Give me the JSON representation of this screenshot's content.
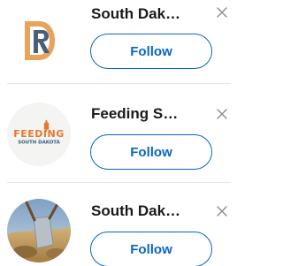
{
  "suggestions": [
    {
      "name": "South Dakota Department of Revenue",
      "display_name": "South Dak…",
      "follow_label": "Follow",
      "avatar_icon": "dor-logo"
    },
    {
      "name": "Feeding South Dakota",
      "display_name": "Feeding S…",
      "follow_label": "Follow",
      "avatar_icon": "feeding-south-dakota-logo",
      "logo_text_top": "FEEDING",
      "logo_text_bottom": "SOUTH DAKOTA"
    },
    {
      "name": "South Dakota",
      "display_name": "South Dak…",
      "follow_label": "Follow",
      "avatar_icon": "landscape-photo"
    }
  ],
  "colors": {
    "accent": "#0a66c2",
    "dismiss": "#8c8c8c",
    "divider": "#e6e6e6",
    "logo_orange": "#e8772e",
    "logo_blue": "#355a7c"
  }
}
